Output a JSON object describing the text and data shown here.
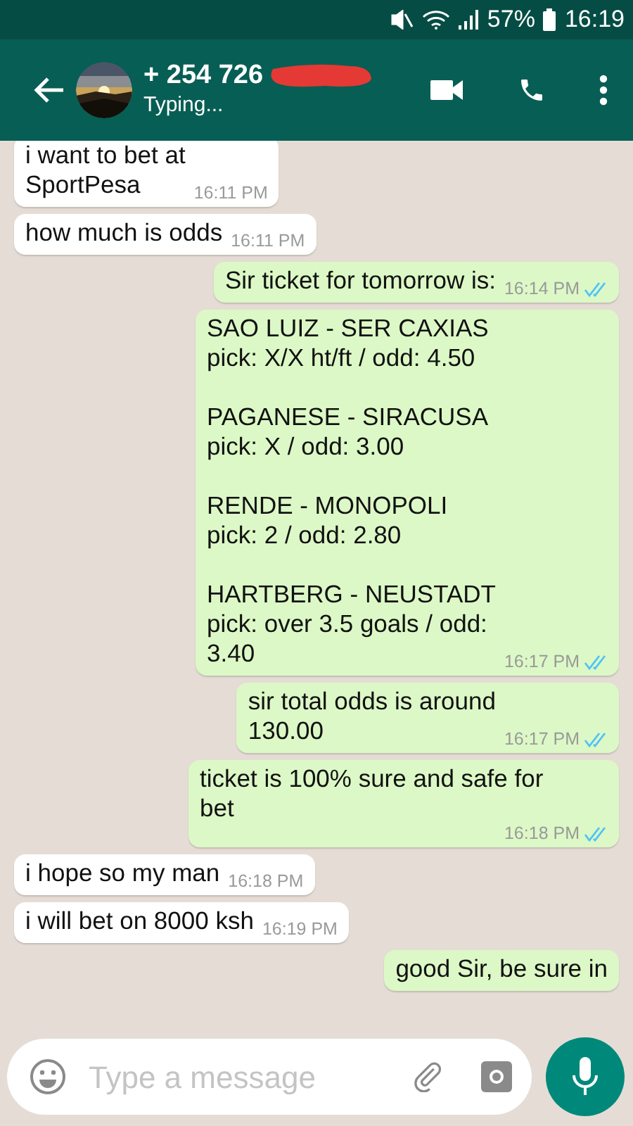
{
  "status_bar": {
    "battery": "57%",
    "time": "16:19"
  },
  "header": {
    "contact": "+ 254 726",
    "redacted": true,
    "status": "Typing..."
  },
  "messages": [
    {
      "kind": "in",
      "text": "i want to bet at\nSportPesa",
      "time": "16:11 PM"
    },
    {
      "kind": "in",
      "text": "how much is odds",
      "time": "16:11 PM"
    },
    {
      "kind": "out",
      "text": "Sir ticket for tomorrow is:",
      "time": "16:14 PM",
      "read": true
    },
    {
      "kind": "out",
      "text": "SAO LUIZ - SER CAXIAS\npick: X/X ht/ft / odd: 4.50\n\nPAGANESE - SIRACUSA\npick: X / odd: 3.00\n\nRENDE - MONOPOLI\npick: 2 / odd: 2.80\n\nHARTBERG - NEUSTADT\npick: over 3.5 goals / odd:\n3.40",
      "time": "16:17 PM",
      "read": true
    },
    {
      "kind": "out",
      "text": "sir total odds is around\n130.00",
      "time": "16:17 PM",
      "read": true
    },
    {
      "kind": "out",
      "text": "ticket is 100% sure and safe for\nbet",
      "time": "16:18 PM",
      "read": true
    },
    {
      "kind": "in",
      "text": "i hope so my man",
      "time": "16:18 PM"
    },
    {
      "kind": "in",
      "text": "i will bet on 8000 ksh",
      "time": "16:19 PM"
    },
    {
      "kind": "out",
      "text": "good Sir, be sure in"
    }
  ],
  "composer": {
    "placeholder": "Type a message"
  }
}
